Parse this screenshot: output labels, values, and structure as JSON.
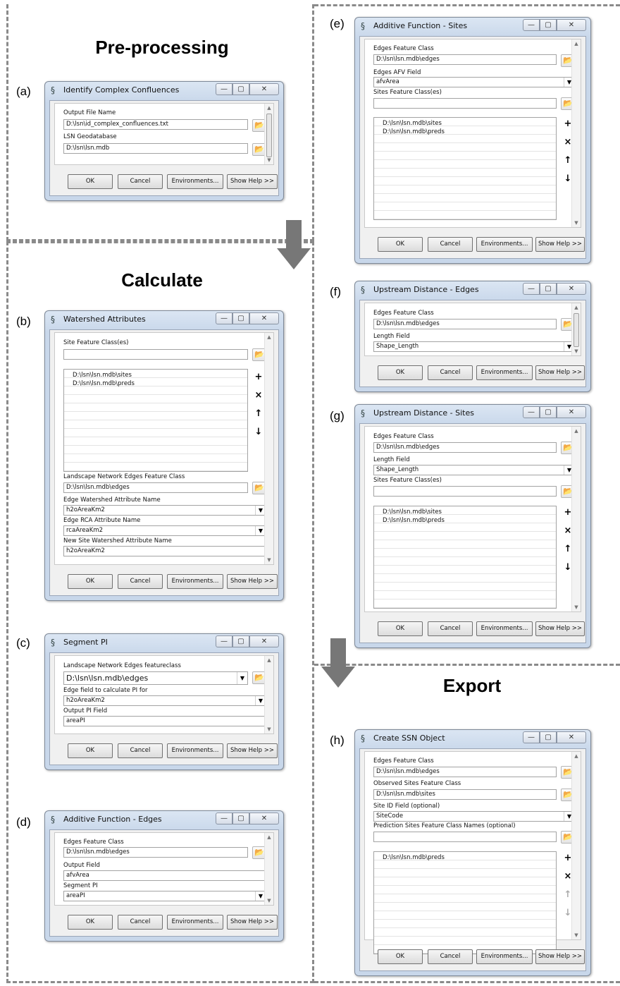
{
  "sections": {
    "pre": "Pre-processing",
    "calc": "Calculate",
    "export": "Export"
  },
  "panels": {
    "a": "(a)",
    "b": "(b)",
    "c": "(c)",
    "d": "(d)",
    "e": "(e)",
    "f": "(f)",
    "g": "(g)",
    "h": "(h)"
  },
  "buttons": {
    "ok": "OK",
    "cancel": "Cancel",
    "env": "Environments...",
    "help": "Show Help >>"
  },
  "window_controls": {
    "minimize": "—",
    "maximize": "▢",
    "close": "✕"
  },
  "dialogs": {
    "a": {
      "title": "Identify Complex Confluences",
      "label1": "Output File Name",
      "value1": "D:\\lsn\\id_complex_confluences.txt",
      "label2": "LSN Geodatabase",
      "value2": "D:\\lsn\\lsn.mdb"
    },
    "b": {
      "title": "Watershed Attributes",
      "label_sites": "Site Feature Class(es)",
      "sites_input": "",
      "items": [
        "D:\\lsn\\lsn.mdb\\sites",
        "D:\\lsn\\lsn.mdb\\preds"
      ],
      "label_edges": "Landscape Network Edges Feature Class",
      "value_edges": "D:\\lsn\\lsn.mdb\\edges",
      "label_ws": "Edge Watershed Attribute Name",
      "value_ws": "h2oAreaKm2",
      "label_rca": "Edge RCA Attribute Name",
      "value_rca": "rcaAreaKm2",
      "label_new": "New Site Watershed Attribute Name",
      "value_new": "h2oAreaKm2"
    },
    "c": {
      "title": "Segment PI",
      "label1": "Landscape Network Edges featureclass",
      "value1": "D:\\lsn\\lsn.mdb\\edges",
      "label2": "Edge field to calculate PI for",
      "value2": "h2oAreaKm2",
      "label3": "Output PI Field",
      "value3": "areaPI"
    },
    "d": {
      "title": "Additive Function - Edges",
      "label1": "Edges Feature Class",
      "value1": "D:\\lsn\\lsn.mdb\\edges",
      "label2": "Output Field",
      "value2": "afvArea",
      "label3": "Segment PI",
      "value3": "areaPI"
    },
    "e": {
      "title": "Additive Function - Sites",
      "label1": "Edges Feature Class",
      "value1": "D:\\lsn\\lsn.mdb\\edges",
      "label2": "Edges AFV Field",
      "value2": "afvArea",
      "label3": "Sites Feature Class(es)",
      "value3": "",
      "items": [
        "D:\\lsn\\lsn.mdb\\sites",
        "D:\\lsn\\lsn.mdb\\preds"
      ]
    },
    "f": {
      "title": "Upstream Distance - Edges",
      "label1": "Edges Feature Class",
      "value1": "D:\\lsn\\lsn.mdb\\edges",
      "label2": "Length Field",
      "value2": "Shape_Length"
    },
    "g": {
      "title": "Upstream Distance - Sites",
      "label1": "Edges Feature Class",
      "value1": "D:\\lsn\\lsn.mdb\\edges",
      "label2": "Length Field",
      "value2": "Shape_Length",
      "label3": "Sites Feature Class(es)",
      "value3": "",
      "items": [
        "D:\\lsn\\lsn.mdb\\sites",
        "D:\\lsn\\lsn.mdb\\preds"
      ]
    },
    "h": {
      "title": "Create SSN Object",
      "label1": "Edges Feature Class",
      "value1": "D:\\lsn\\lsn.mdb\\edges",
      "label2": "Observed Sites Feature Class",
      "value2": "D:\\lsn\\lsn.mdb\\sites",
      "label3": "Site ID Field (optional)",
      "value3": "SiteCode",
      "label4": "Prediction Sites Feature Class Names (optional)",
      "value4": "",
      "items": [
        "D:\\lsn\\lsn.mdb\\preds"
      ]
    }
  }
}
